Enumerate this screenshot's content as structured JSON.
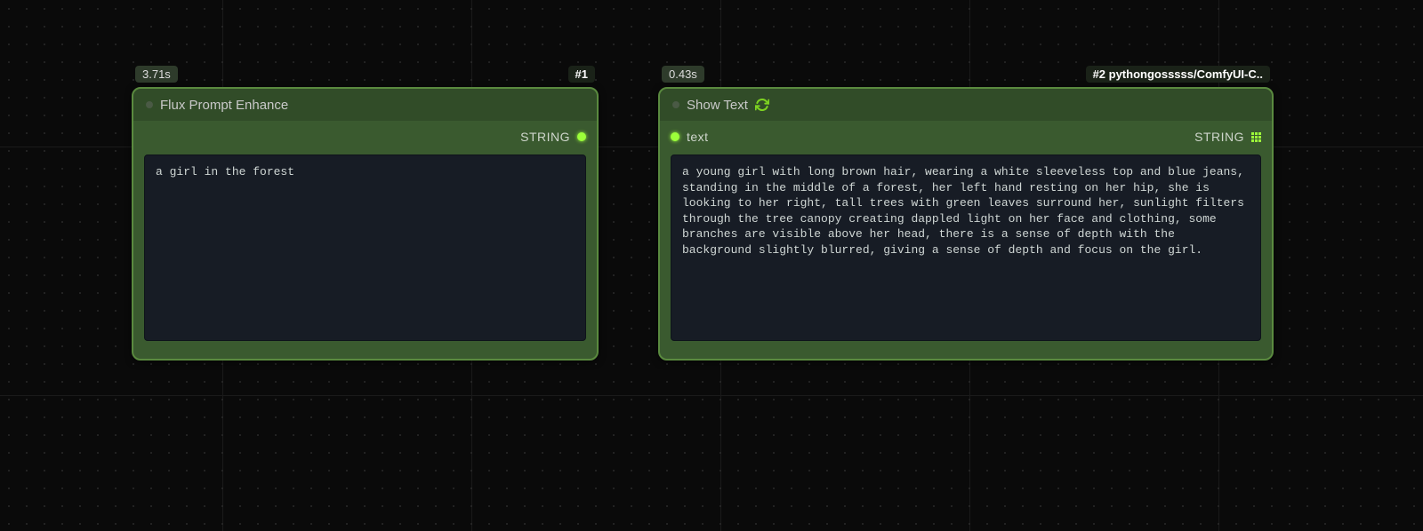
{
  "nodes": [
    {
      "badge_time": "3.71s",
      "badge_id": "#1",
      "title": "Flux Prompt Enhance",
      "output_label": "STRING",
      "content": "a girl in the forest"
    },
    {
      "badge_time": "0.43s",
      "badge_id": "#2 pythongosssss/ComfyUI-C..",
      "title": "Show Text",
      "input_label": "text",
      "output_label": "STRING",
      "content": "a young girl with long brown hair, wearing a white sleeveless top and blue jeans, standing in the middle of a forest, her left hand resting on her hip, she is looking to her right, tall trees with green leaves surround her, sunlight filters through the tree canopy creating dappled light on her face and clothing, some branches are visible above her head, there is a sense of depth with the background slightly blurred, giving a sense of depth and focus on the girl."
    }
  ]
}
